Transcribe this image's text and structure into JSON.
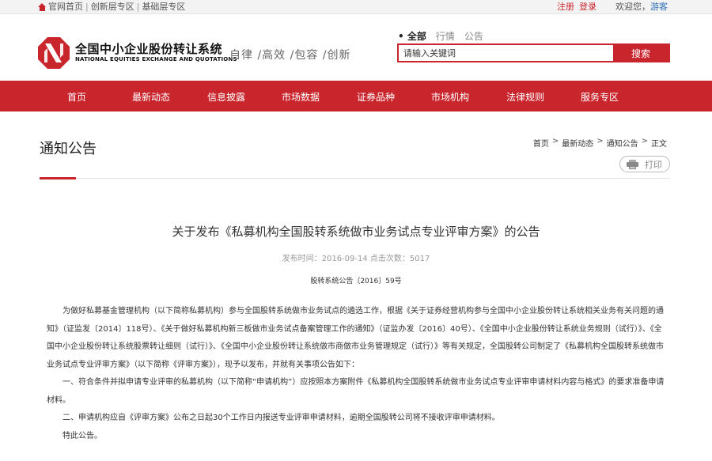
{
  "topbar": {
    "links": [
      "官网首页",
      "创新层专区",
      "基础层专区"
    ],
    "register": "注册",
    "login": "登录",
    "welcome": "欢迎您，",
    "guest": "游客"
  },
  "logo": {
    "cn": "全国中小企业股份转让系统",
    "en": "NATIONAL EQUITIES EXCHANGE AND QUOTATIONS"
  },
  "slogan": "自律 /高效 /包容 /创新",
  "search": {
    "tabs": [
      "全部",
      "行情",
      "公告"
    ],
    "placeholder": "请输入关键词",
    "button": "搜索"
  },
  "nav": [
    "首页",
    "最新动态",
    "信息披露",
    "市场数据",
    "证券品种",
    "市场机构",
    "法律规则",
    "服务专区"
  ],
  "page": {
    "title": "通知公告",
    "breadcrumb": [
      "首页",
      "最新动态",
      "通知公告",
      "正文"
    ],
    "print": "打印"
  },
  "article": {
    "title": "关于发布《私募机构全国股转系统做市业务试点专业评审方案》的公告",
    "meta": "发布时间：2016-09-14 点击次数：5017",
    "docno": "股转系统公告〔2016〕59号",
    "paragraphs": [
      "为做好私募基金管理机构（以下简称私募机构）参与全国股转系统做市业务试点的遴选工作，根据《关于证券经营机构参与全国中小企业股份转让系统相关业务有关问题的通知》（证监发〔2014〕118号）、《关于做好私募机构新三板做市业务试点备案管理工作的通知》（证监办发〔2016〕40号）、《全国中小企业股份转让系统业务规则（试行）》、《全国中小企业股份转让系统股票转让细则（试行）》、《全国中小企业股份转让系统做市商做市业务管理规定（试行）》等有关规定，全国股转公司制定了《私募机构全国股转系统做市业务试点专业评审方案》（以下简称《评审方案》），现予以发布，并就有关事项公告如下：",
      "一、符合条件并拟申请专业评审的私募机构（以下简称“申请机构”）应按照本方案附件《私募机构全国股转系统做市业务试点专业评审申请材料内容与格式》的要求准备申请材料。",
      "二、申请机构应自《评审方案》公布之日起30个工作日内报送专业评审申请材料，逾期全国股转公司将不接收评审申请材料。",
      "特此公告。"
    ]
  },
  "colors": {
    "brand": "#c9252d",
    "link": "#2a6fb6"
  }
}
